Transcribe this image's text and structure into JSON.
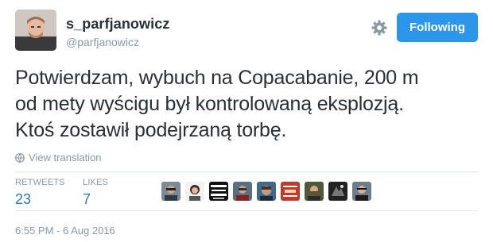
{
  "user": {
    "display_name": "s_parfjanowicz",
    "username": "@parfjanowicz"
  },
  "follow_button": {
    "label": "Following"
  },
  "icons": {
    "settings": "gear-icon",
    "translate": "globe-icon"
  },
  "tweet": {
    "text_lines": [
      "Potwierdzam, wybuch na Copacabanie, 200 m",
      "od mety wyścigu był kontrolowaną eksplozją.",
      "Ktoś zostawił podejrzaną torbę."
    ]
  },
  "translation": {
    "label": "View translation"
  },
  "stats": {
    "retweets_label": "RETWEETS",
    "retweets_value": "23",
    "likes_label": "LIKES",
    "likes_value": "7"
  },
  "timestamp": "6:55 PM - 6 Aug 2016",
  "colors": {
    "accent": "#2b96ea",
    "link": "#2b7bb9",
    "muted": "#8899a6",
    "text": "#292f33"
  }
}
